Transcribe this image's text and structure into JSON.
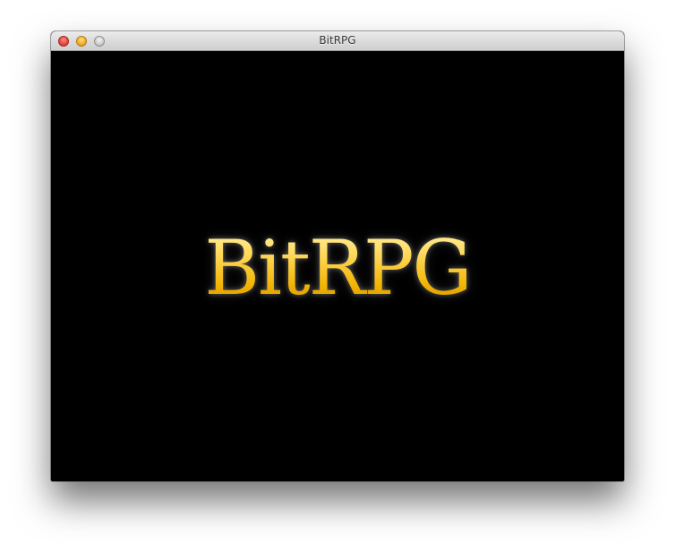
{
  "window": {
    "title": "BitRPG"
  },
  "game": {
    "logo_text": "BitRPG"
  },
  "colors": {
    "logo_gold": "#f2b400",
    "background": "#000000"
  }
}
